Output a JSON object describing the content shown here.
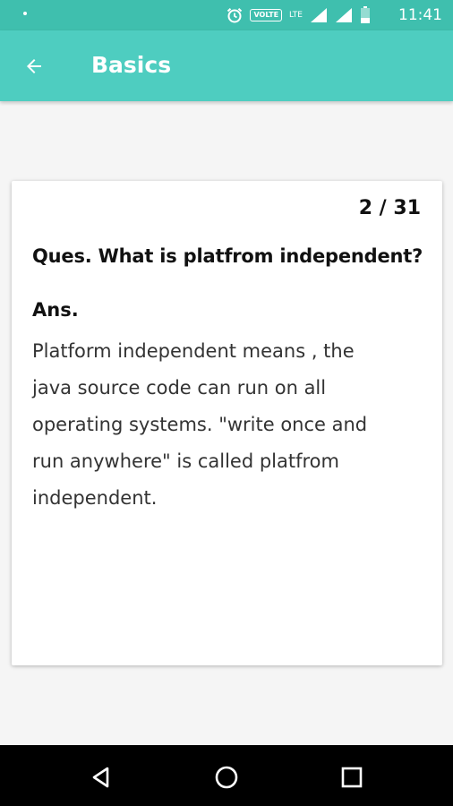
{
  "status_bar": {
    "time": "11:41",
    "volte_label": "VOLTE",
    "lte_label": "LTE",
    "icons": [
      "alarm-icon",
      "volte-icon",
      "lte-icon",
      "signal-icon",
      "signal-icon",
      "battery-icon"
    ]
  },
  "app_bar": {
    "title": "Basics",
    "back_icon": "arrow-back-icon"
  },
  "card": {
    "counter": "2 / 31",
    "question": "Ques. What is platfrom independent?",
    "answer_label": "Ans.",
    "answer_lines": [
      "Platform independent means , the",
      "java source code can run on all",
      "operating systems. \"write once and",
      "run anywhere\" is called platfrom",
      "independent."
    ]
  },
  "nav_bar": {
    "icons": [
      "back-triangle-icon",
      "home-circle-icon",
      "recents-square-icon"
    ]
  }
}
